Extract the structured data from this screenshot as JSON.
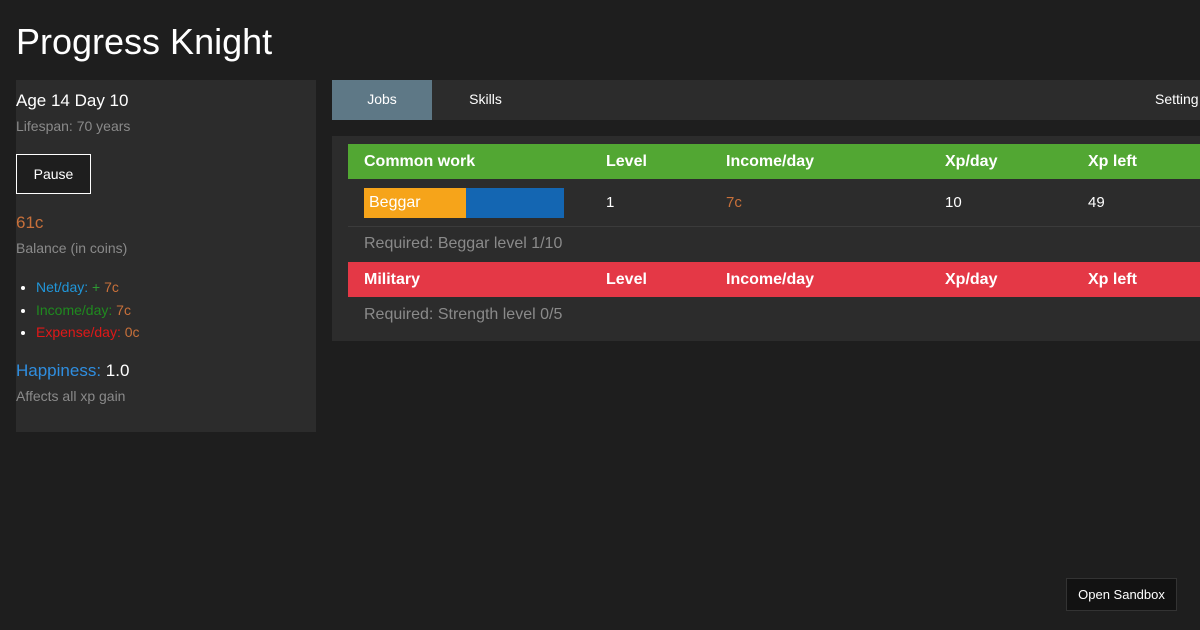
{
  "app": {
    "title": "Progress Knight"
  },
  "info": {
    "age": "Age 14 Day 10",
    "lifespan": "Lifespan: 70 years",
    "pause_label": "Pause",
    "balance_value": "61c",
    "balance_label": "Balance (in coins)",
    "net_label": "Net/day:",
    "net_sign": "+",
    "net_value": "7c",
    "income_label": "Income/day:",
    "income_value": "7c",
    "expense_label": "Expense/day:",
    "expense_value": "0c",
    "happiness_label": "Happiness:",
    "happiness_value": "1.0",
    "happiness_note": "Affects all xp gain"
  },
  "tabs": [
    {
      "label": "Jobs",
      "active": true
    },
    {
      "label": "Skills",
      "active": false
    },
    {
      "label": "Setting",
      "active": false
    }
  ],
  "columns": [
    "Level",
    "Income/day",
    "Xp/day",
    "Xp left"
  ],
  "categories": [
    {
      "name": "Common work",
      "color": "#52a733",
      "jobs": [
        {
          "name": "Beggar",
          "progress": 0.51,
          "level": "1",
          "income": "7c",
          "xp_day": "10",
          "xp_left": "49"
        }
      ],
      "required": "Required: Beggar level 1/10"
    },
    {
      "name": "Military",
      "color": "#e43846",
      "jobs": [],
      "required": "Required: Strength level 0/5"
    }
  ],
  "sandbox_label": "Open Sandbox",
  "colors": {
    "background": "#1e1e1e",
    "panel": "#2c2c2c",
    "active_tab": "#5e7886",
    "progress_fill": "#f6a41a",
    "progress_track": "#1466b2",
    "coin": "#c8703a"
  }
}
